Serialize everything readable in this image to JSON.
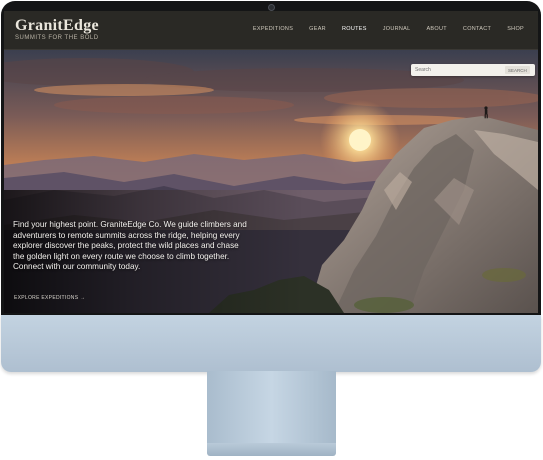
{
  "site": {
    "logo": "GranitEdge",
    "tagline": "SUMMITS FOR THE BOLD"
  },
  "nav": {
    "items": [
      {
        "label": "EXPEDITIONS",
        "active": false
      },
      {
        "label": "GEAR",
        "active": false
      },
      {
        "label": "ROUTES",
        "active": true
      },
      {
        "label": "JOURNAL",
        "active": false
      },
      {
        "label": "ABOUT",
        "active": false
      },
      {
        "label": "CONTACT",
        "active": false
      },
      {
        "label": "SHOP",
        "active": false
      }
    ]
  },
  "search": {
    "placeholder": "Search",
    "button_label": "SEARCH"
  },
  "hero": {
    "paragraph": "Find your highest point. GraniteEdge Co. We guide climbers and adventurers to remote summits across the ridge, helping every explorer discover the peaks, protect the wild places and chase the golden light on every route we choose to climb together. Connect with our community today.",
    "link_label": "EXPLORE EXPEDITIONS →"
  },
  "colors": {
    "sky_top": "#3b3f4f",
    "sun": "#fff4c8",
    "rock": "#8f8680",
    "stand": "#b8cadb"
  }
}
